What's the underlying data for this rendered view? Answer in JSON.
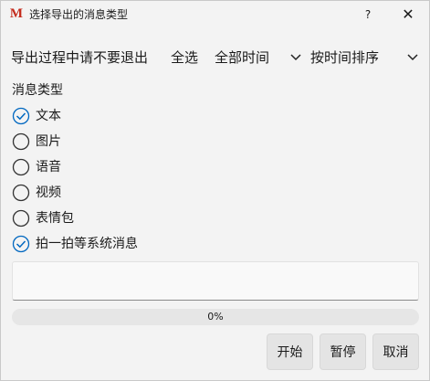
{
  "window": {
    "title": "选择导出的消息类型",
    "logo": "M",
    "help_label": "?",
    "close_label": "✕"
  },
  "toolbar": {
    "notice": "导出过程中请不要退出",
    "select_all": "全选",
    "time_filter": "全部时间",
    "sort_order": "按时间排序"
  },
  "message_types": {
    "label": "消息类型",
    "options": [
      {
        "label": "文本",
        "checked": true
      },
      {
        "label": "图片",
        "checked": false
      },
      {
        "label": "语音",
        "checked": false
      },
      {
        "label": "视频",
        "checked": false
      },
      {
        "label": "表情包",
        "checked": false
      },
      {
        "label": "拍一拍等系统消息",
        "checked": true
      }
    ]
  },
  "log_box": {
    "value": ""
  },
  "progress": {
    "percent": 0,
    "label": "0%"
  },
  "buttons": {
    "start": "开始",
    "pause": "暂停",
    "cancel": "取消"
  },
  "colors": {
    "accent": "#0067c0",
    "logo": "#c42b1c"
  }
}
